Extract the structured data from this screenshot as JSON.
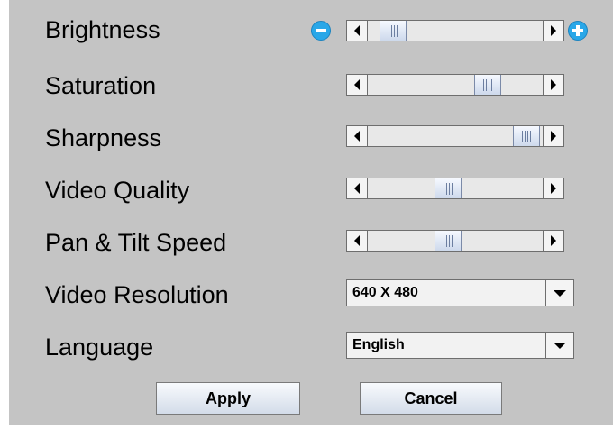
{
  "settings": {
    "brightness": {
      "label": "Brightness",
      "value_percent": 8,
      "decrease_icon": "minus-circle-icon",
      "increase_icon": "plus-circle-icon"
    },
    "saturation": {
      "label": "Saturation",
      "value_percent": 72
    },
    "sharpness": {
      "label": "Sharpness",
      "value_percent": 98
    },
    "video_quality": {
      "label": "Video Quality",
      "value_percent": 45
    },
    "pan_tilt_speed": {
      "label": "Pan & Tilt Speed",
      "value_percent": 45
    },
    "video_resolution": {
      "label": "Video Resolution",
      "selected": "640 X 480"
    },
    "language": {
      "label": "Language",
      "selected": "English"
    }
  },
  "buttons": {
    "apply_label": "Apply",
    "cancel_label": "Cancel"
  },
  "colors": {
    "panel_background": "#c4c4c4",
    "round_button_accent": "#29a7e8"
  }
}
